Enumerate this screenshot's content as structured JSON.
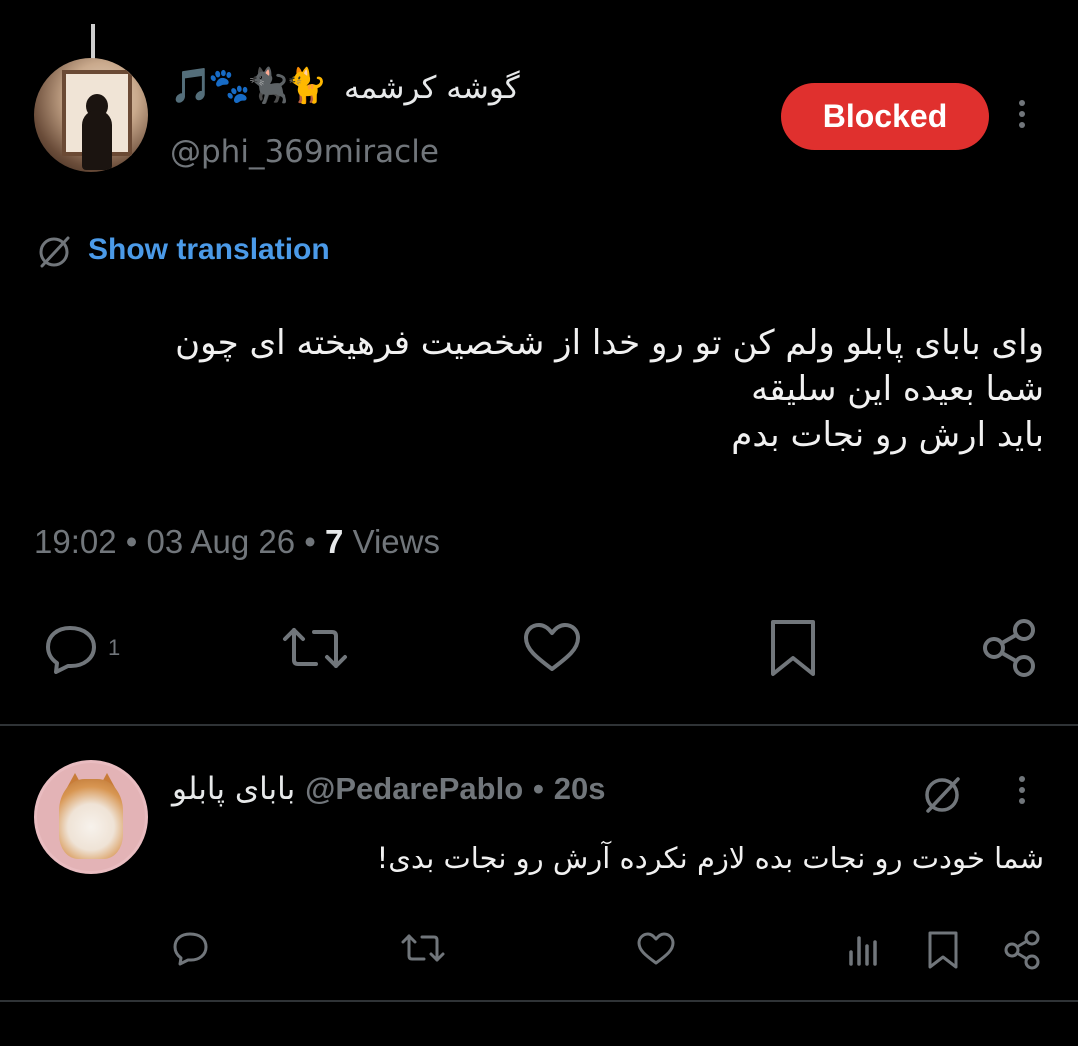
{
  "tweet": {
    "author_name": "گوشه کرشمه",
    "author_emoji": "🎵🐾🐈‍⬛🐈",
    "author_handle": "@phi_369miracle",
    "blocked_label": "Blocked",
    "translation_link": "Show translation",
    "text_lines": [
      "وای بابای پابلو ولم کن تو رو خدا از شخصیت فرهیخته ای چون",
      "شما بعیده این سلیقه",
      "باید ارش رو نجات بدم"
    ],
    "time": "19:02",
    "date": "03 Aug 26",
    "views_count": "7",
    "views_label": "Views",
    "reply_count": "1",
    "icons": [
      "reply-icon",
      "retweet-icon",
      "like-icon",
      "bookmark-icon",
      "share-icon"
    ]
  },
  "reply": {
    "author_name": "بابای پابلو",
    "author_handle": "@PedarePablo",
    "age": "20s",
    "text": "شما خودت رو نجات بده لازم نکرده آرش رو نجات بدی!",
    "icons": [
      "reply-icon",
      "retweet-icon",
      "like-icon",
      "views-icon",
      "bookmark-icon",
      "share-icon"
    ]
  },
  "colors": {
    "background": "#000000",
    "text": "#e7e9ea",
    "muted": "#71767b",
    "link": "#4b9ae8",
    "blocked": "#e0302e",
    "divider": "#2f3336"
  }
}
